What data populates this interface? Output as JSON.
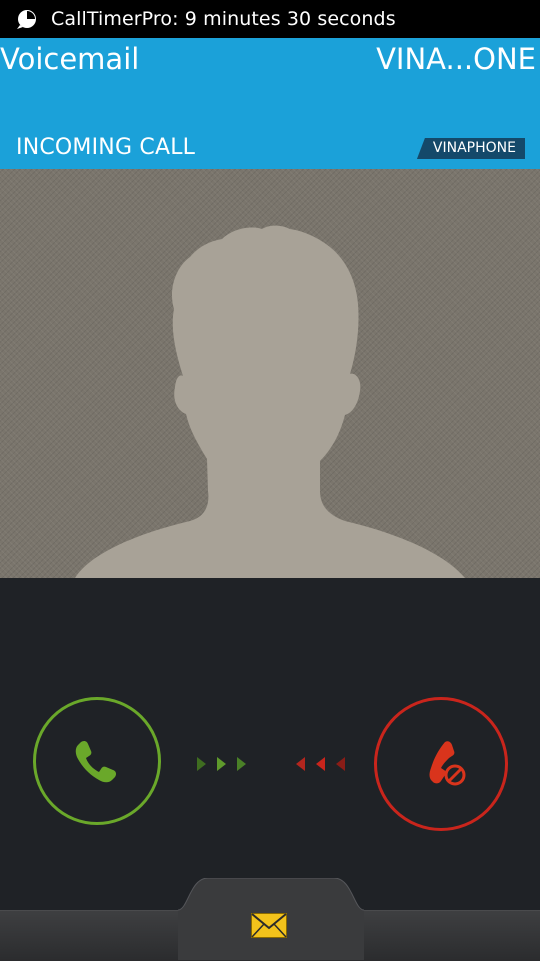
{
  "status_bar": {
    "app_icon": "calltimer-icon",
    "text": "CallTimerPro: 9 minutes 30 seconds"
  },
  "header": {
    "label": "Voicemail",
    "number": "VINA...ONE",
    "incoming_text": "INCOMING CALL",
    "carrier_badge": "VINAPHONE",
    "background_color": "#1ba1d9"
  },
  "contact_photo": {
    "icon": "default-person-silhouette-icon"
  },
  "controls": {
    "answer": {
      "icon": "phone-answer-icon",
      "color": "#6aa82a"
    },
    "decline": {
      "icon": "phone-decline-icon",
      "color": "#c9251c"
    },
    "answer_arrows_color": "#5f9a2c",
    "decline_arrows_color": "#b3261e"
  },
  "tray": {
    "message_icon": "envelope-icon",
    "message_icon_color": "#f2c21b"
  }
}
